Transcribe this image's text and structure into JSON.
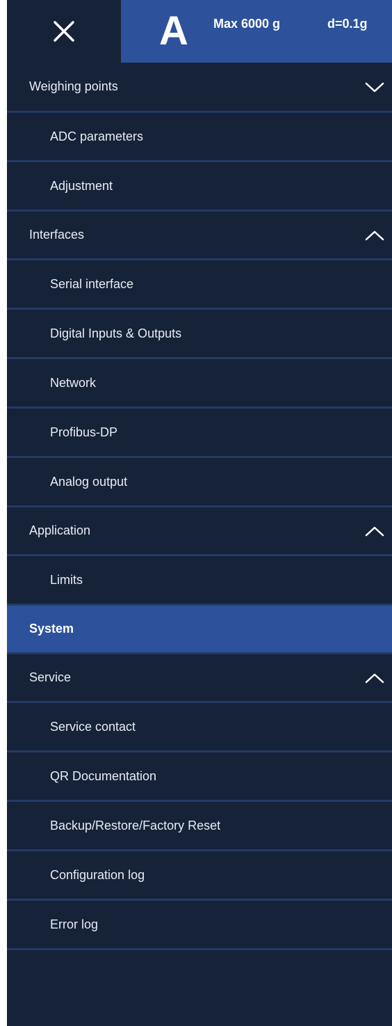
{
  "header": {
    "close_icon": "close-icon",
    "scale_letter": "A",
    "capacity": "Max 6000 g",
    "division": "d=0.1g"
  },
  "menu": [
    {
      "label": "Weighing points",
      "type": "group",
      "chevron": "down"
    },
    {
      "label": "ADC parameters",
      "type": "sub"
    },
    {
      "label": "Adjustment",
      "type": "sub"
    },
    {
      "label": "Interfaces",
      "type": "group",
      "chevron": "up"
    },
    {
      "label": "Serial interface",
      "type": "sub"
    },
    {
      "label": "Digital Inputs & Outputs",
      "type": "sub"
    },
    {
      "label": "Network",
      "type": "sub"
    },
    {
      "label": "Profibus-DP",
      "type": "sub"
    },
    {
      "label": "Analog output",
      "type": "sub"
    },
    {
      "label": "Application",
      "type": "group",
      "chevron": "up"
    },
    {
      "label": "Limits",
      "type": "sub"
    },
    {
      "label": "System",
      "type": "group",
      "active": true
    },
    {
      "label": "Service",
      "type": "group",
      "chevron": "up"
    },
    {
      "label": "Service contact",
      "type": "sub"
    },
    {
      "label": "QR Documentation",
      "type": "sub"
    },
    {
      "label": "Backup/Restore/Factory Reset",
      "type": "sub"
    },
    {
      "label": "Configuration log",
      "type": "sub"
    },
    {
      "label": "Error log",
      "type": "sub"
    }
  ],
  "colors": {
    "background": "#162238",
    "accent": "#2d519a",
    "divider": "#243a66",
    "text": "#e8edf5"
  }
}
